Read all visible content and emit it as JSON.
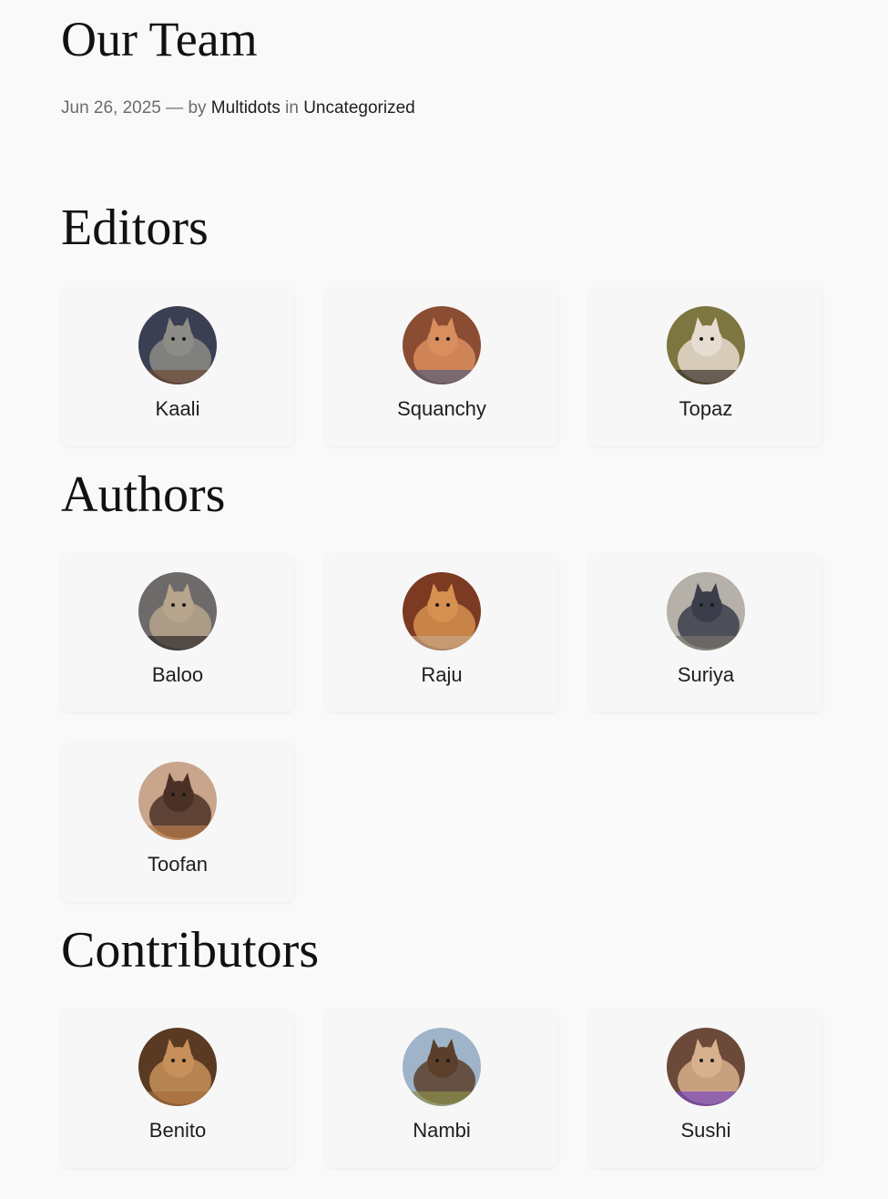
{
  "post": {
    "title": "Our Team",
    "date": "Jun 26, 2025",
    "separator": "—",
    "by_label": "by",
    "author": "Multidots",
    "in_label": "in",
    "category": "Uncategorized"
  },
  "sections": {
    "editors": {
      "title": "Editors",
      "members": [
        {
          "name": "Kaali",
          "avatar": "black-cat-photo",
          "colors": [
            "#3a3f52",
            "#8d8c86",
            "#6d4a35"
          ]
        },
        {
          "name": "Squanchy",
          "avatar": "orange-cat-photo",
          "colors": [
            "#8a4d33",
            "#d98e5e",
            "#5a5e7a"
          ]
        },
        {
          "name": "Topaz",
          "avatar": "white-dog-photo",
          "colors": [
            "#7e7640",
            "#e6dcd0",
            "#3a2f2a"
          ]
        }
      ]
    },
    "authors": {
      "title": "Authors",
      "members": [
        {
          "name": "Baloo",
          "avatar": "tabby-cat-photo",
          "colors": [
            "#6e6a6a",
            "#b7a58c",
            "#2e2a28"
          ]
        },
        {
          "name": "Raju",
          "avatar": "ginger-cat-photo",
          "colors": [
            "#7c3a22",
            "#d6904f",
            "#c7a485"
          ]
        },
        {
          "name": "Suriya",
          "avatar": "gray-cat-photo",
          "colors": [
            "#b5b0a8",
            "#3a3e4a",
            "#77736b"
          ]
        },
        {
          "name": "Toofan",
          "avatar": "kitten-photo",
          "colors": [
            "#c9a58c",
            "#4b3026",
            "#b77e4c"
          ]
        }
      ]
    },
    "contributors": {
      "title": "Contributors",
      "members": [
        {
          "name": "Benito",
          "avatar": "brown-dog-photo",
          "colors": [
            "#5a3a22",
            "#c7905a",
            "#a76d3c"
          ]
        },
        {
          "name": "Nambi",
          "avatar": "shepherd-dog-photo",
          "colors": [
            "#9fb4c9",
            "#5b3f2b",
            "#8a8f4a"
          ]
        },
        {
          "name": "Sushi",
          "avatar": "calico-cat-photo",
          "colors": [
            "#6b4a3a",
            "#d7b08c",
            "#7a4ac0"
          ]
        }
      ]
    }
  }
}
